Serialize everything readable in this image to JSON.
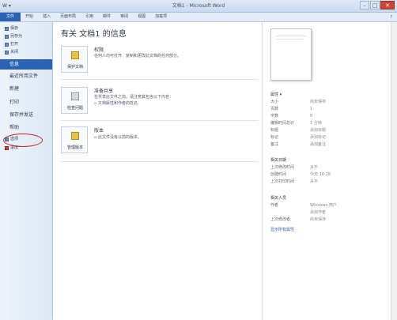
{
  "titlebar": {
    "quick_access": "W ▾",
    "title": "文档1 - Microsoft Word",
    "minimize": "–",
    "maximize": "□",
    "close": "✕"
  },
  "ribbon": {
    "tabs": [
      "文件",
      "开始",
      "插入",
      "页面布局",
      "引用",
      "邮件",
      "审阅",
      "视图",
      "加载项"
    ],
    "help": "?"
  },
  "sidebar": {
    "commands": [
      "保存",
      "另存为",
      "打开",
      "关闭"
    ],
    "sections": [
      "信息",
      "最近所用文件",
      "新建",
      "打印",
      "保存并发送",
      "帮助"
    ],
    "bottom_commands": [
      "选项",
      "退出"
    ]
  },
  "main": {
    "heading": "有关 文档1 的信息",
    "sections": [
      {
        "button_label": "保护文档",
        "title": "权限",
        "desc": [
          "任何人均可打开、复制和更改此文档的任何部分。"
        ]
      },
      {
        "button_label": "检查问题",
        "title": "准备共享",
        "desc": [
          "在共享此文件之前，请注意其包含以下内容：",
          "▫ 文档属性和作者的姓名"
        ]
      },
      {
        "button_label": "管理版本",
        "title": "版本",
        "desc": [
          "▫ 此文件没有以前的版本。"
        ]
      }
    ]
  },
  "properties": {
    "header": "属性 ▾",
    "rows": [
      {
        "k": "大小",
        "v": "尚未保存"
      },
      {
        "k": "页数",
        "v": "1"
      },
      {
        "k": "字数",
        "v": "0"
      },
      {
        "k": "编辑时间总计",
        "v": "1 分钟"
      },
      {
        "k": "标题",
        "v": "添加标题"
      },
      {
        "k": "标记",
        "v": "添加标记"
      },
      {
        "k": "备注",
        "v": "添加备注"
      }
    ],
    "dates_header": "相关日期",
    "dates": [
      {
        "k": "上次修改时间",
        "v": "从不"
      },
      {
        "k": "创建时间",
        "v": "今天 10:28"
      },
      {
        "k": "上次打印时间",
        "v": "从不"
      }
    ],
    "people_header": "相关人员",
    "people": [
      {
        "k": "作者",
        "v": "Windows 用户"
      },
      {
        "k": "",
        "v": "添加作者"
      },
      {
        "k": "上次修改者",
        "v": "尚未保存"
      }
    ],
    "show_all": "显示所有属性"
  }
}
